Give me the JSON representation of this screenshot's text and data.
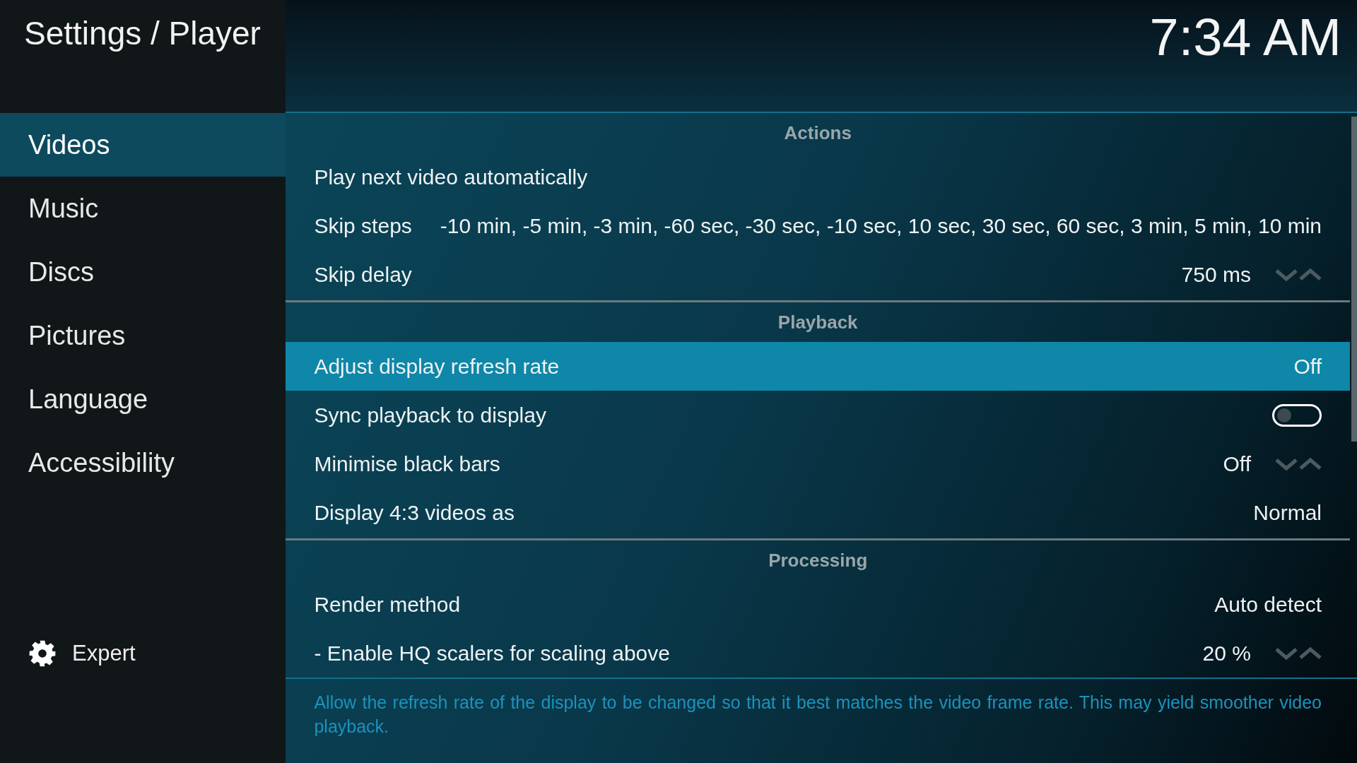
{
  "window": {
    "title": "Settings / Player"
  },
  "clock": "7:34 AM",
  "categories": [
    {
      "label": "Videos",
      "selected": true
    },
    {
      "label": "Music",
      "selected": false
    },
    {
      "label": "Discs",
      "selected": false
    },
    {
      "label": "Pictures",
      "selected": false
    },
    {
      "label": "Language",
      "selected": false
    },
    {
      "label": "Accessibility",
      "selected": false
    }
  ],
  "expert": {
    "label": "Expert"
  },
  "sections": [
    {
      "title": "Actions",
      "rows": [
        {
          "label": "Play next video automatically",
          "kind": "plain",
          "selected": false
        },
        {
          "label": "Skip steps",
          "kind": "value",
          "value": "-10 min, -5 min, -3 min, -60 sec, -30 sec, -10 sec, 10 sec, 30 sec, 60 sec, 3 min, 5 min, 10 min",
          "selected": false
        },
        {
          "label": "Skip delay",
          "kind": "spinner",
          "value": "750 ms",
          "selected": false
        }
      ]
    },
    {
      "title": "Playback",
      "rows": [
        {
          "label": "Adjust display refresh rate",
          "kind": "value",
          "value": "Off",
          "selected": true
        },
        {
          "label": "Sync playback to display",
          "kind": "toggle",
          "on": false,
          "selected": false
        },
        {
          "label": "Minimise black bars",
          "kind": "spinner",
          "value": "Off",
          "selected": false
        },
        {
          "label": "Display 4:3 videos as",
          "kind": "value",
          "value": "Normal",
          "selected": false
        }
      ]
    },
    {
      "title": "Processing",
      "rows": [
        {
          "label": "Render method",
          "kind": "value",
          "value": "Auto detect",
          "selected": false
        },
        {
          "label": "- Enable HQ scalers for scaling above",
          "kind": "spinner",
          "value": "20 %",
          "selected": false
        }
      ]
    }
  ],
  "description": "Allow the refresh rate of the display to be changed so that it best matches the video frame rate. This may yield smoother video playback."
}
